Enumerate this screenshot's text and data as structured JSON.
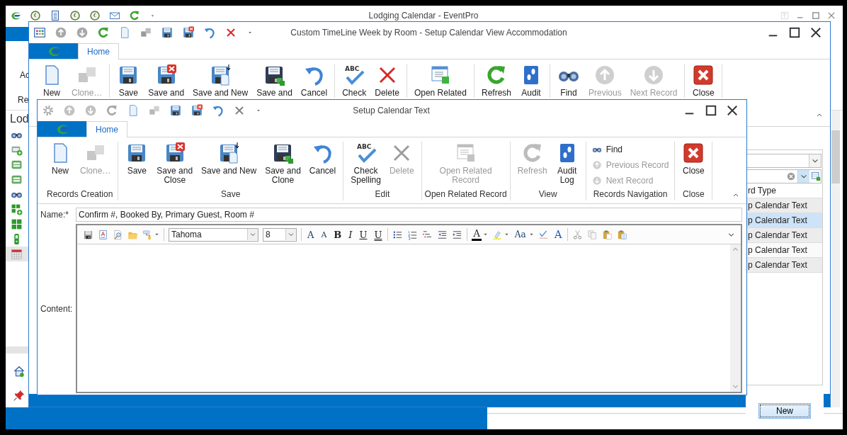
{
  "main_window": {
    "title": "Lodging Calendar - EventPro",
    "ribbon_labels": [
      "Ac",
      "Re"
    ],
    "panel_title": "Lod",
    "nav_items": [
      {
        "kind": "find",
        "selected": false
      },
      {
        "kind": "bedadd",
        "selected": false
      },
      {
        "kind": "bed",
        "selected": false
      },
      {
        "kind": "bed",
        "selected": false
      },
      {
        "kind": "find",
        "selected": false
      },
      {
        "kind": "gridadd",
        "selected": false
      },
      {
        "kind": "grid",
        "selected": false
      },
      {
        "kind": "device",
        "selected": false
      },
      {
        "kind": "calendar",
        "selected": true
      }
    ]
  },
  "view_window": {
    "title": "Custom TimeLine Week by Room - Setup Calendar View Accommodation",
    "tab": {
      "label": "Home",
      "selected": true
    },
    "groups": [
      {
        "buttons": [
          {
            "kind": "new",
            "label": "New",
            "disabled": false
          },
          {
            "kind": "clone",
            "label": "Clone…",
            "disabled": true
          }
        ]
      },
      {
        "buttons": [
          {
            "kind": "save",
            "label": "Save",
            "disabled": false
          },
          {
            "kind": "saveclose",
            "label": "Save and",
            "disabled": false
          },
          {
            "kind": "savenew",
            "label": "Save and New",
            "disabled": false
          },
          {
            "kind": "saveclone",
            "label": "Save and",
            "disabled": false
          },
          {
            "kind": "cancel",
            "label": "Cancel",
            "disabled": false
          }
        ]
      },
      {
        "buttons": [
          {
            "kind": "spelling",
            "mark": "ABC",
            "label": "Check",
            "disabled": false
          },
          {
            "kind": "delete",
            "label": "Delete",
            "disabled": false
          }
        ]
      },
      {
        "buttons": [
          {
            "kind": "related",
            "label": "Open Related",
            "disabled": false
          }
        ]
      },
      {
        "buttons": [
          {
            "kind": "refresh",
            "label": "Refresh",
            "disabled": false
          },
          {
            "kind": "audit",
            "label": "Audit",
            "disabled": false
          }
        ]
      },
      {
        "buttons": [
          {
            "kind": "find",
            "label": "Find",
            "disabled": false
          },
          {
            "kind": "previous",
            "label": "Previous",
            "disabled": true
          },
          {
            "kind": "next",
            "label": "Next Record",
            "disabled": true
          }
        ]
      },
      {
        "buttons": [
          {
            "kind": "close",
            "label": "Close",
            "disabled": false
          }
        ]
      }
    ],
    "record_list": {
      "column": "rd Type",
      "rows": [
        {
          "text": "p Calendar Text",
          "selected": false
        },
        {
          "text": "p Calendar Text",
          "selected": true
        },
        {
          "text": "p Calendar Text",
          "selected": false
        },
        {
          "text": "p Calendar Text",
          "selected": false
        },
        {
          "text": "p Calendar Text",
          "selected": false
        }
      ]
    },
    "new_button": "New"
  },
  "text_window": {
    "title": "Setup Calendar Text",
    "tab": {
      "label": "Home",
      "selected": true
    },
    "groups": [
      {
        "label": "Records Creation",
        "kind": "large",
        "buttons": [
          {
            "kind": "new",
            "label": "New",
            "disabled": false
          },
          {
            "kind": "clone",
            "label": "Clone…",
            "disabled": true
          }
        ]
      },
      {
        "label": "Save",
        "kind": "large",
        "buttons": [
          {
            "kind": "save",
            "label": "Save",
            "disabled": false
          },
          {
            "kind": "saveclose",
            "label": "Save and\nClose",
            "disabled": false
          },
          {
            "kind": "savenew",
            "label": "Save and New",
            "disabled": false
          },
          {
            "kind": "saveclone",
            "label": "Save and\nClone",
            "disabled": false
          },
          {
            "kind": "cancel",
            "label": "Cancel",
            "disabled": false
          }
        ]
      },
      {
        "label": "Edit",
        "kind": "large",
        "buttons": [
          {
            "kind": "spelling",
            "mark": "ABC",
            "label": "Check\nSpelling",
            "disabled": false
          },
          {
            "kind": "delete",
            "label": "Delete",
            "disabled": true
          }
        ]
      },
      {
        "label": "Open Related Record",
        "kind": "large",
        "buttons": [
          {
            "kind": "related",
            "label": "Open Related\nRecord",
            "disabled": true
          }
        ]
      },
      {
        "label": "View",
        "kind": "large",
        "buttons": [
          {
            "kind": "refresh",
            "label": "Refresh",
            "disabled": true
          },
          {
            "kind": "audit",
            "label": "Audit\nLog",
            "disabled": false
          }
        ]
      },
      {
        "label": "Records Navigation",
        "kind": "small",
        "buttons": [
          {
            "kind": "find",
            "label": "Find",
            "disabled": false
          },
          {
            "kind": "previous",
            "label": "Previous Record",
            "disabled": true
          },
          {
            "kind": "next",
            "label": "Next Record",
            "disabled": true
          }
        ]
      },
      {
        "label": "Close",
        "kind": "large",
        "buttons": [
          {
            "kind": "close",
            "label": "Close",
            "disabled": false
          }
        ]
      }
    ],
    "form": {
      "name_label": "Name:*",
      "name_value": "Confirm #, Booked By, Primary Guest, Room #",
      "content_label": "Content:",
      "editor_toolbar": [
        {
          "kind": "savegrey"
        },
        {
          "kind": "style"
        },
        {
          "kind": "preview"
        },
        {
          "kind": "open"
        },
        {
          "kind": "brush"
        },
        {
          "kind": "font",
          "value": "Tahoma"
        },
        {
          "kind": "size",
          "value": "8"
        },
        {
          "kind": "grow",
          "text": "A"
        },
        {
          "kind": "shrink",
          "text": "A"
        },
        {
          "kind": "bold",
          "text": "B"
        },
        {
          "kind": "italic",
          "text": "I"
        },
        {
          "kind": "underline",
          "text": "U"
        },
        {
          "kind": "dunderline",
          "text": "U"
        },
        {
          "kind": "bullets"
        },
        {
          "kind": "numbers"
        },
        {
          "kind": "multilevel"
        },
        {
          "kind": "outdent"
        },
        {
          "kind": "indent"
        },
        {
          "kind": "color",
          "text": "A"
        },
        {
          "kind": "highlight"
        },
        {
          "kind": "case",
          "text": "Aa"
        },
        {
          "kind": "spell"
        },
        {
          "kind": "clear",
          "text": "A"
        },
        {
          "kind": "cut"
        },
        {
          "kind": "copy"
        },
        {
          "kind": "paste"
        },
        {
          "kind": "pastespecial"
        }
      ]
    }
  }
}
